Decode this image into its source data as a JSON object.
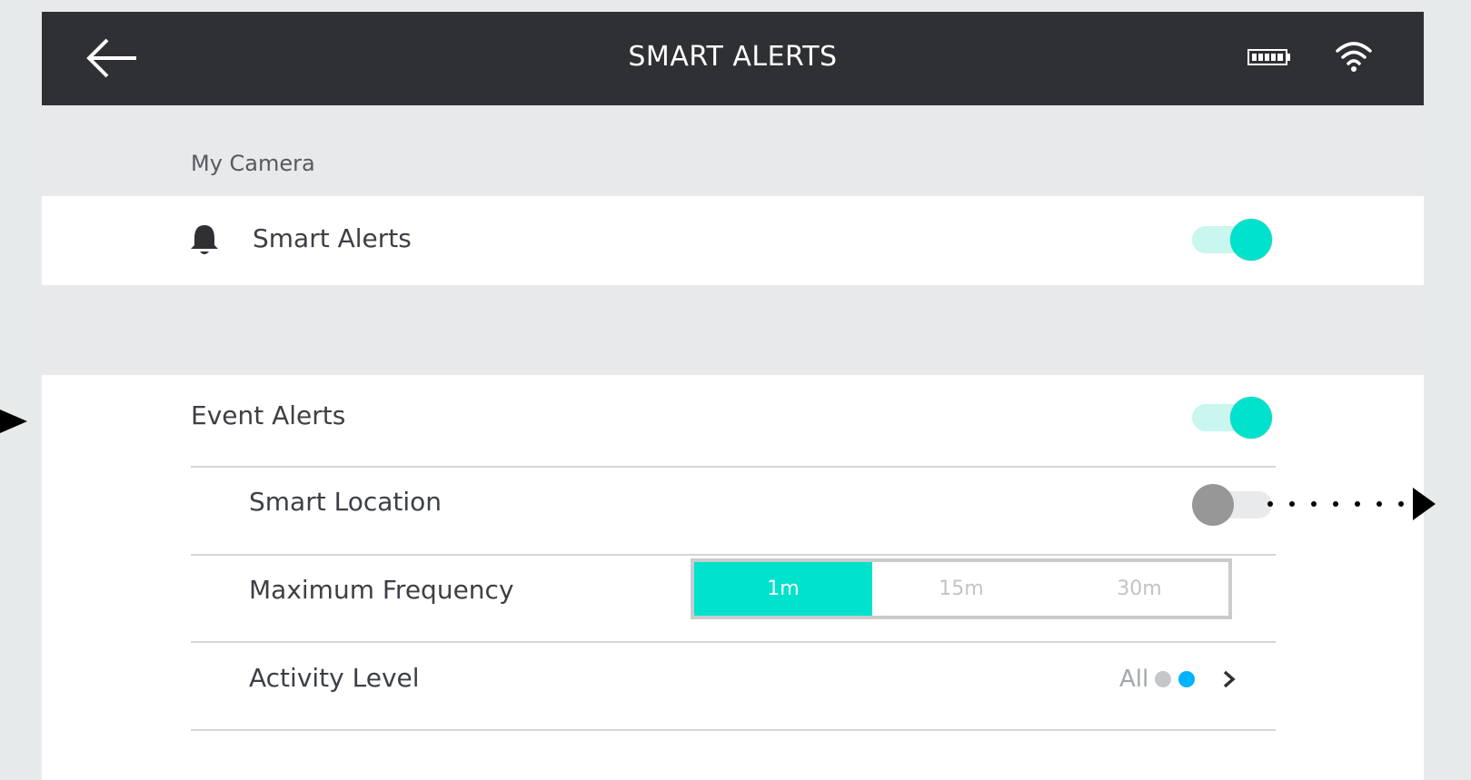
{
  "header": {
    "title": "SMART ALERTS",
    "back_icon": "arrow-left-icon",
    "battery_icon": "battery-icon",
    "wifi_icon": "wifi-icon"
  },
  "sections": {
    "camera_name": "My Camera"
  },
  "smart_alerts": {
    "label": "Smart Alerts",
    "icon": "bell-icon",
    "enabled": true
  },
  "event_alerts": {
    "label": "Event Alerts",
    "enabled": true
  },
  "smart_location": {
    "label": "Smart Location",
    "enabled": false
  },
  "maximum_frequency": {
    "label": "Maximum Frequency",
    "options": [
      "1m",
      "15m",
      "30m"
    ],
    "selected": "1m"
  },
  "activity_level": {
    "label": "Activity Level",
    "value": "All",
    "dot_colors": [
      "#c4c8cb",
      "#00b2ff"
    ]
  },
  "colors": {
    "accent": "#00e2cc",
    "header_bg": "#2f3033"
  }
}
